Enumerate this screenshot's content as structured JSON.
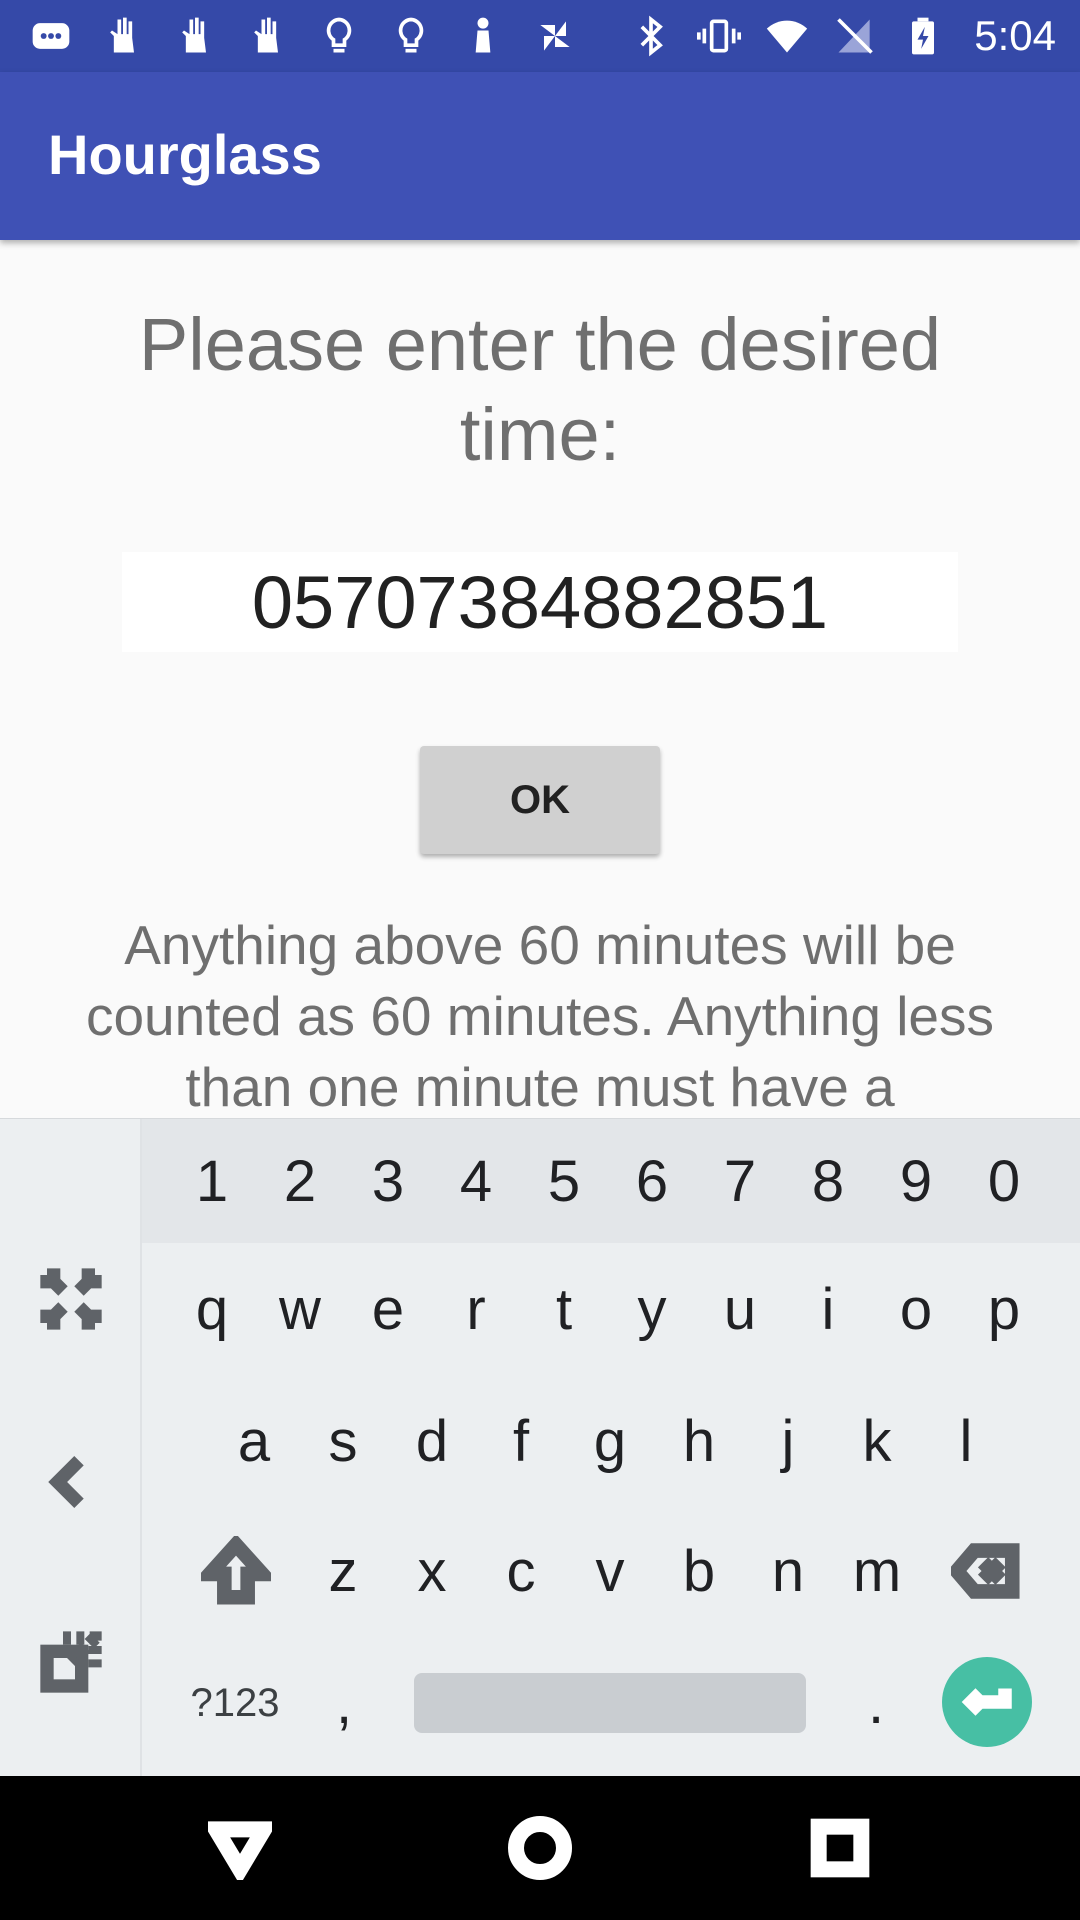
{
  "status_bar": {
    "time": "5:04",
    "left_icons": [
      "chat-icon",
      "hand-icon",
      "hand-icon",
      "hand-icon",
      "bulb-icon",
      "bulb-icon",
      "person-icon",
      "pinwheel-icon"
    ],
    "right_icons": [
      "bluetooth-icon",
      "vibrate-icon",
      "wifi-icon",
      "no-sim-icon",
      "battery-charging-icon"
    ]
  },
  "app_bar": {
    "title": "Hourglass"
  },
  "main": {
    "prompt": "Please enter the desired time:",
    "time_input_value": "05707384882851",
    "ok_label": "OK",
    "info_text": "Anything above 60 minutes will be counted as 60 minutes. Anything less than one minute must have a"
  },
  "keyboard": {
    "number_row": [
      "1",
      "2",
      "3",
      "4",
      "5",
      "6",
      "7",
      "8",
      "9",
      "0"
    ],
    "row1": [
      "q",
      "w",
      "e",
      "r",
      "t",
      "y",
      "u",
      "i",
      "o",
      "p"
    ],
    "row2": [
      "a",
      "s",
      "d",
      "f",
      "g",
      "h",
      "j",
      "k",
      "l"
    ],
    "row3": [
      "z",
      "x",
      "c",
      "v",
      "b",
      "n",
      "m"
    ],
    "symbols_label": "?123",
    "comma": ",",
    "period": ".",
    "side_icons": [
      "expand-icon",
      "back-chevron-icon",
      "popout-icon"
    ],
    "accent_color": "#47bfa4"
  },
  "colors": {
    "status_bar": "#3549a8",
    "app_bar": "#3f51b5"
  }
}
